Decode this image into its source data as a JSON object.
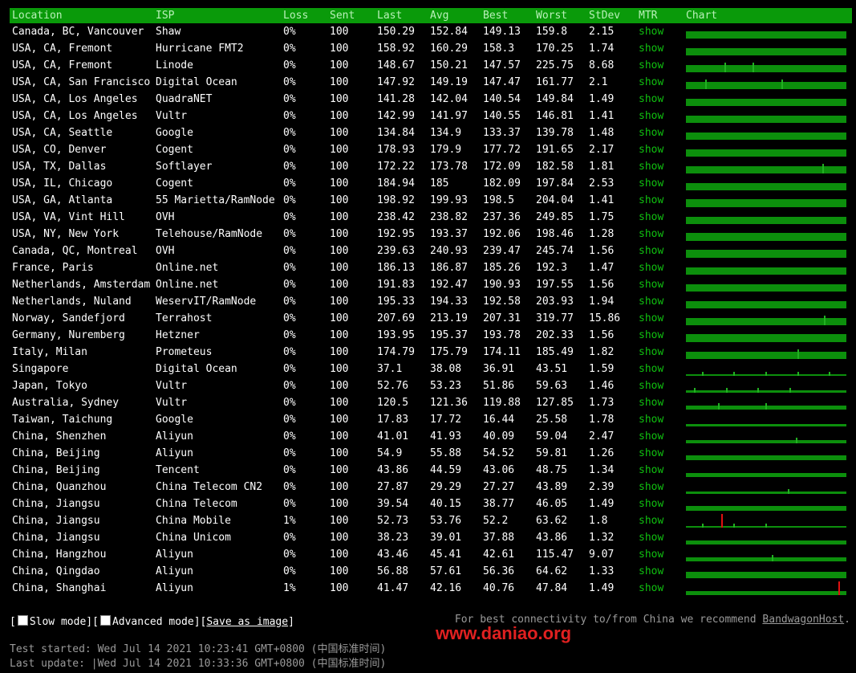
{
  "headers": [
    "Location",
    "ISP",
    "Loss",
    "Sent",
    "Last",
    "Avg",
    "Best",
    "Worst",
    "StDev",
    "MTR",
    "Chart"
  ],
  "rows": [
    [
      "Canada, BC, Vancouver",
      "Shaw",
      "0%",
      "100",
      "150.29",
      "152.84",
      "149.13",
      "159.8",
      "2.15",
      "show"
    ],
    [
      "USA, CA, Fremont",
      "Hurricane FMT2",
      "0%",
      "100",
      "158.92",
      "160.29",
      "158.3",
      "170.25",
      "1.74",
      "show"
    ],
    [
      "USA, CA, Fremont",
      "Linode",
      "0%",
      "100",
      "148.67",
      "150.21",
      "147.57",
      "225.75",
      "8.68",
      "show"
    ],
    [
      "USA, CA, San Francisco",
      "Digital Ocean",
      "0%",
      "100",
      "147.92",
      "149.19",
      "147.47",
      "161.77",
      "2.1",
      "show"
    ],
    [
      "USA, CA, Los Angeles",
      "QuadraNET",
      "0%",
      "100",
      "141.28",
      "142.04",
      "140.54",
      "149.84",
      "1.49",
      "show"
    ],
    [
      "USA, CA, Los Angeles",
      "Vultr",
      "0%",
      "100",
      "142.99",
      "141.97",
      "140.55",
      "146.81",
      "1.41",
      "show"
    ],
    [
      "USA, CA, Seattle",
      "Google",
      "0%",
      "100",
      "134.84",
      "134.9",
      "133.37",
      "139.78",
      "1.48",
      "show"
    ],
    [
      "USA, CO, Denver",
      "Cogent",
      "0%",
      "100",
      "178.93",
      "179.9",
      "177.72",
      "191.65",
      "2.17",
      "show"
    ],
    [
      "USA, TX, Dallas",
      "Softlayer",
      "0%",
      "100",
      "172.22",
      "173.78",
      "172.09",
      "182.58",
      "1.81",
      "show"
    ],
    [
      "USA, IL, Chicago",
      "Cogent",
      "0%",
      "100",
      "184.94",
      "185",
      "182.09",
      "197.84",
      "2.53",
      "show"
    ],
    [
      "USA, GA, Atlanta",
      "55 Marietta/RamNode",
      "0%",
      "100",
      "198.92",
      "199.93",
      "198.5",
      "204.04",
      "1.41",
      "show"
    ],
    [
      "USA, VA, Vint Hill",
      "OVH",
      "0%",
      "100",
      "238.42",
      "238.82",
      "237.36",
      "249.85",
      "1.75",
      "show"
    ],
    [
      "USA, NY, New York",
      "Telehouse/RamNode",
      "0%",
      "100",
      "192.95",
      "193.37",
      "192.06",
      "198.46",
      "1.28",
      "show"
    ],
    [
      "Canada, QC, Montreal",
      "OVH",
      "0%",
      "100",
      "239.63",
      "240.93",
      "239.47",
      "245.74",
      "1.56",
      "show"
    ],
    [
      "France, Paris",
      "Online.net",
      "0%",
      "100",
      "186.13",
      "186.87",
      "185.26",
      "192.3",
      "1.47",
      "show"
    ],
    [
      "Netherlands, Amsterdam",
      "Online.net",
      "0%",
      "100",
      "191.83",
      "192.47",
      "190.93",
      "197.55",
      "1.56",
      "show"
    ],
    [
      "Netherlands, Nuland",
      "WeservIT/RamNode",
      "0%",
      "100",
      "195.33",
      "194.33",
      "192.58",
      "203.93",
      "1.94",
      "show"
    ],
    [
      "Norway, Sandefjord",
      "Terrahost",
      "0%",
      "100",
      "207.69",
      "213.19",
      "207.31",
      "319.77",
      "15.86",
      "show"
    ],
    [
      "Germany, Nuremberg",
      "Hetzner",
      "0%",
      "100",
      "193.95",
      "195.37",
      "193.78",
      "202.33",
      "1.56",
      "show"
    ],
    [
      "Italy, Milan",
      "Prometeus",
      "0%",
      "100",
      "174.79",
      "175.79",
      "174.11",
      "185.49",
      "1.82",
      "show"
    ],
    [
      "Singapore",
      "Digital Ocean",
      "0%",
      "100",
      "37.1",
      "38.08",
      "36.91",
      "43.51",
      "1.59",
      "show"
    ],
    [
      "Japan, Tokyo",
      "Vultr",
      "0%",
      "100",
      "52.76",
      "53.23",
      "51.86",
      "59.63",
      "1.46",
      "show"
    ],
    [
      "Australia, Sydney",
      "Vultr",
      "0%",
      "100",
      "120.5",
      "121.36",
      "119.88",
      "127.85",
      "1.73",
      "show"
    ],
    [
      "Taiwan, Taichung",
      "Google",
      "0%",
      "100",
      "17.83",
      "17.72",
      "16.44",
      "25.58",
      "1.78",
      "show"
    ],
    [
      "China, Shenzhen",
      "Aliyun",
      "0%",
      "100",
      "41.01",
      "41.93",
      "40.09",
      "59.04",
      "2.47",
      "show"
    ],
    [
      "China, Beijing",
      "Aliyun",
      "0%",
      "100",
      "54.9",
      "55.88",
      "54.52",
      "59.81",
      "1.26",
      "show"
    ],
    [
      "China, Beijing",
      "Tencent",
      "0%",
      "100",
      "43.86",
      "44.59",
      "43.06",
      "48.75",
      "1.34",
      "show"
    ],
    [
      "China, Quanzhou",
      "China Telecom CN2",
      "0%",
      "100",
      "27.87",
      "29.29",
      "27.27",
      "43.89",
      "2.39",
      "show"
    ],
    [
      "China, Jiangsu",
      "China Telecom",
      "0%",
      "100",
      "39.54",
      "40.15",
      "38.77",
      "46.05",
      "1.49",
      "show"
    ],
    [
      "China, Jiangsu",
      "China Mobile",
      "1%",
      "100",
      "52.73",
      "53.76",
      "52.2",
      "63.62",
      "1.8",
      "show"
    ],
    [
      "China, Jiangsu",
      "China Unicom",
      "0%",
      "100",
      "38.23",
      "39.01",
      "37.88",
      "43.86",
      "1.32",
      "show"
    ],
    [
      "China, Hangzhou",
      "Aliyun",
      "0%",
      "100",
      "43.46",
      "45.41",
      "42.61",
      "115.47",
      "9.07",
      "show"
    ],
    [
      "China, Qingdao",
      "Aliyun",
      "0%",
      "100",
      "56.88",
      "57.61",
      "56.36",
      "64.62",
      "1.33",
      "show"
    ],
    [
      "China, Shanghai",
      "Aliyun",
      "1%",
      "100",
      "41.47",
      "42.16",
      "40.76",
      "47.84",
      "1.49",
      "show"
    ]
  ],
  "charts": [
    {
      "level": 0.5,
      "spikes": [],
      "loss": null
    },
    {
      "level": 0.55,
      "spikes": [],
      "loss": null
    },
    {
      "level": 0.5,
      "spikes": [
        0.24,
        0.42
      ],
      "loss": null
    },
    {
      "level": 0.5,
      "spikes": [
        0.12,
        0.6
      ],
      "loss": null
    },
    {
      "level": 0.5,
      "spikes": [],
      "loss": null
    },
    {
      "level": 0.55,
      "spikes": [],
      "loss": null
    },
    {
      "level": 0.55,
      "spikes": [],
      "loss": null
    },
    {
      "level": 0.5,
      "spikes": [],
      "loss": null
    },
    {
      "level": 0.5,
      "spikes": [
        0.86
      ],
      "loss": null
    },
    {
      "level": 0.5,
      "spikes": [],
      "loss": null
    },
    {
      "level": 0.6,
      "spikes": [],
      "loss": null
    },
    {
      "level": 0.55,
      "spikes": [],
      "loss": null
    },
    {
      "level": 0.6,
      "spikes": [],
      "loss": null
    },
    {
      "level": 0.6,
      "spikes": [],
      "loss": null
    },
    {
      "level": 0.55,
      "spikes": [],
      "loss": null
    },
    {
      "level": 0.55,
      "spikes": [],
      "loss": null
    },
    {
      "level": 0.55,
      "spikes": [],
      "loss": null
    },
    {
      "level": 0.5,
      "spikes": [
        0.87
      ],
      "loss": null
    },
    {
      "level": 0.6,
      "spikes": [],
      "loss": null
    },
    {
      "level": 0.55,
      "spikes": [
        0.7
      ],
      "loss": null
    },
    {
      "level": 0.12,
      "spikes": [
        0.1,
        0.3,
        0.5,
        0.7,
        0.9
      ],
      "loss": null
    },
    {
      "level": 0.2,
      "spikes": [
        0.05,
        0.25,
        0.45,
        0.65
      ],
      "loss": null
    },
    {
      "level": 0.3,
      "spikes": [
        0.2,
        0.5
      ],
      "loss": null
    },
    {
      "level": 0.15,
      "spikes": [],
      "loss": null
    },
    {
      "level": 0.25,
      "spikes": [
        0.69
      ],
      "loss": null
    },
    {
      "level": 0.35,
      "spikes": [],
      "loss": null
    },
    {
      "level": 0.3,
      "spikes": [],
      "loss": null
    },
    {
      "level": 0.2,
      "spikes": [
        0.64
      ],
      "loss": null
    },
    {
      "level": 0.35,
      "spikes": [],
      "loss": null
    },
    {
      "level": 0.12,
      "spikes": [
        0.1,
        0.3,
        0.5
      ],
      "loss": 0.22
    },
    {
      "level": 0.3,
      "spikes": [],
      "loss": null
    },
    {
      "level": 0.3,
      "spikes": [
        0.54
      ],
      "loss": null
    },
    {
      "level": 0.45,
      "spikes": [],
      "loss": null
    },
    {
      "level": 0.3,
      "spikes": [],
      "loss": 0.96
    }
  ],
  "controls": {
    "open_bracket": "[",
    "slow_mode": "Slow mode",
    "mid": "][",
    "advanced_mode": "Advanced mode",
    "sep": "][",
    "save_image": "Save as image",
    "close_bracket": "]"
  },
  "recommend": {
    "text": "For best connectivity to/from China we recommend ",
    "link": "BandwagonHost",
    "period": "."
  },
  "watermark": "www.daniao.org",
  "times": {
    "started": "Test started: Wed Jul 14 2021 10:23:41 GMT+0800 (中国标准时间)",
    "update": "Last update: |Wed Jul 14 2021 10:33:36 GMT+0800 (中国标准时间)"
  },
  "colors": {
    "header_bg": "#0a9a0a",
    "chart_fill": "#0c8f0c",
    "loss": "#e01010",
    "link": "#10c010"
  }
}
